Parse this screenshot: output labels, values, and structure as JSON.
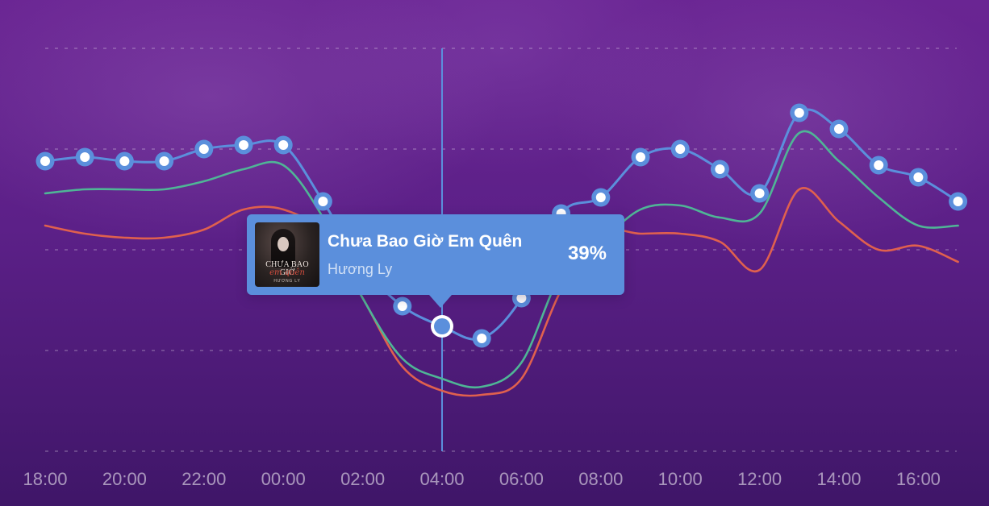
{
  "chart_data": {
    "type": "line",
    "x": [
      "18:00",
      "19:00",
      "20:00",
      "21:00",
      "22:00",
      "23:00",
      "00:00",
      "01:00",
      "02:00",
      "03:00",
      "04:00",
      "05:00",
      "06:00",
      "07:00",
      "08:00",
      "09:00",
      "10:00",
      "11:00",
      "12:00",
      "13:00",
      "14:00",
      "15:00",
      "16:00",
      "17:00"
    ],
    "xticks": [
      "18:00",
      "20:00",
      "22:00",
      "00:00",
      "02:00",
      "04:00",
      "06:00",
      "08:00",
      "10:00",
      "12:00",
      "14:00",
      "16:00"
    ],
    "ylim": [
      0,
      100
    ],
    "grid": true,
    "series": [
      {
        "color": "#5b8fdc",
        "markers": true,
        "values": [
          72,
          73,
          72,
          72,
          75,
          76,
          76,
          62,
          46,
          36,
          31,
          28,
          38,
          59,
          63,
          73,
          75,
          70,
          64,
          84,
          80,
          71,
          68,
          62
        ]
      },
      {
        "color": "#4fb596",
        "markers": false,
        "values": [
          64,
          65,
          65,
          65,
          67,
          70,
          71,
          58,
          38,
          23,
          18,
          16,
          22,
          44,
          52,
          60,
          61,
          58,
          59,
          79,
          72,
          63,
          56,
          56
        ]
      },
      {
        "color": "#e0604e",
        "markers": false,
        "values": [
          56,
          54,
          53,
          53,
          55,
          60,
          60,
          54,
          38,
          21,
          15,
          14,
          18,
          40,
          54,
          54,
          54,
          52,
          45,
          65,
          57,
          50,
          51,
          47
        ]
      }
    ],
    "highlight_index": 10,
    "tooltip": {
      "title": "Chưa Bao Giờ Em Quên",
      "artist": "Hương Ly",
      "value": "39%",
      "cover_title": "CHƯA BAO GIỜ",
      "cover_script": "em quên",
      "cover_artist": "HƯƠNG LY"
    }
  },
  "colors": {
    "line_primary": "#5b8fdc",
    "line_secondary": "#4fb596",
    "line_tertiary": "#e0604e",
    "tooltip_bg": "#5b8fdc"
  }
}
